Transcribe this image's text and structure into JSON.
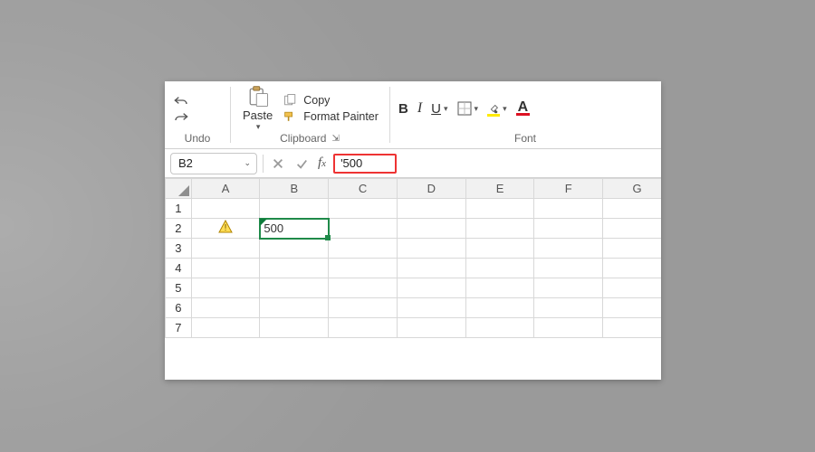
{
  "ribbon": {
    "undo": {
      "label": "Undo"
    },
    "clipboard": {
      "label": "Clipboard",
      "paste": "Paste",
      "copy": "Copy",
      "format_painter": "Format Painter"
    },
    "font": {
      "label": "Font"
    }
  },
  "formula_bar": {
    "name_box": "B2",
    "formula": "'500"
  },
  "grid": {
    "columns": [
      "A",
      "B",
      "C",
      "D",
      "E",
      "F",
      "G"
    ],
    "rows": [
      "1",
      "2",
      "3",
      "4",
      "5",
      "6",
      "7"
    ],
    "selected_cell": "B2",
    "cells": {
      "B2": "500"
    }
  }
}
